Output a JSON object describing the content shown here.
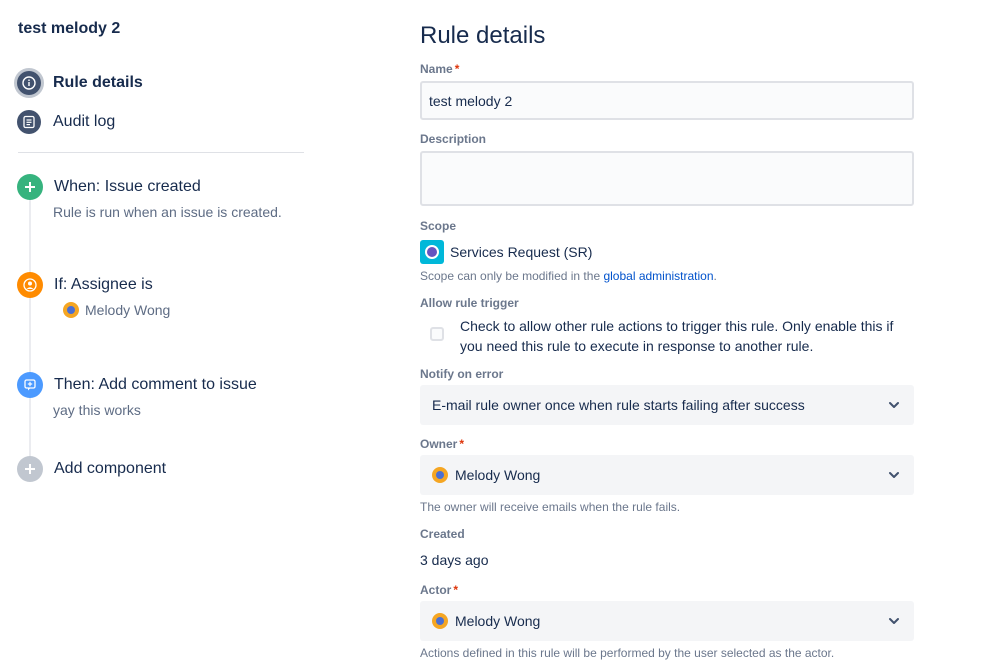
{
  "sidebar": {
    "rule_name": "test melody 2",
    "nav": [
      {
        "label": "Rule details",
        "icon": "info-icon",
        "active": true
      },
      {
        "label": "Audit log",
        "icon": "list-icon",
        "active": false
      }
    ],
    "components": [
      {
        "title": "When: Issue created",
        "description": "Rule is run when an issue is created.",
        "icon": "plus-icon",
        "color": "#36b37e"
      },
      {
        "title": "If: Assignee is",
        "description": "Melody Wong",
        "icon": "user-icon",
        "color": "#ff8b00",
        "has_avatar": true
      },
      {
        "title": "Then: Add comment to issue",
        "description": "yay this works",
        "icon": "comment-icon",
        "color": "#4c9aff"
      },
      {
        "title": "Add component",
        "icon": "plus-icon",
        "color": "#c1c7d0"
      }
    ]
  },
  "main": {
    "title": "Rule details",
    "name": {
      "label": "Name",
      "required_mark": "*",
      "value": "test melody 2"
    },
    "description": {
      "label": "Description",
      "value": ""
    },
    "scope": {
      "label": "Scope",
      "value": "Services Request (SR)",
      "helper_prefix": "Scope can only be modified in the ",
      "helper_link": "global administration",
      "helper_suffix": "."
    },
    "allow_trigger": {
      "label": "Allow rule trigger",
      "text": "Check to allow other rule actions to trigger this rule. Only enable this if you need this rule to execute in response to another rule.",
      "checked": false
    },
    "notify": {
      "label": "Notify on error",
      "value": "E-mail rule owner once when rule starts failing after success"
    },
    "owner": {
      "label": "Owner",
      "required_mark": "*",
      "value": "Melody Wong",
      "helper": "The owner will receive emails when the rule fails."
    },
    "created": {
      "label": "Created",
      "value": "3 days ago"
    },
    "actor": {
      "label": "Actor",
      "required_mark": "*",
      "value": "Melody Wong",
      "helper": "Actions defined in this rule will be performed by the user selected as the actor."
    }
  }
}
